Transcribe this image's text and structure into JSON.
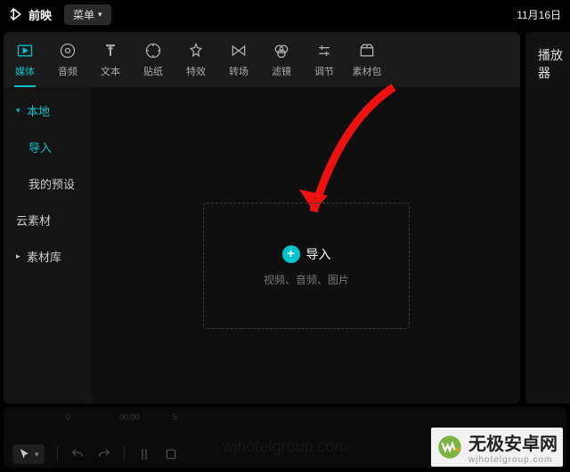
{
  "titlebar": {
    "app_name": "前映",
    "menu_label": "菜单",
    "date": "11月16日"
  },
  "tabs": [
    {
      "id": "media",
      "label": "媒体",
      "icon": "media",
      "active": true
    },
    {
      "id": "audio",
      "label": "音频",
      "icon": "audio"
    },
    {
      "id": "text",
      "label": "文本",
      "icon": "text"
    },
    {
      "id": "sticker",
      "label": "贴纸",
      "icon": "sticker"
    },
    {
      "id": "effect",
      "label": "特效",
      "icon": "effect"
    },
    {
      "id": "transition",
      "label": "转场",
      "icon": "transition"
    },
    {
      "id": "filter",
      "label": "滤镜",
      "icon": "filter"
    },
    {
      "id": "adjust",
      "label": "调节",
      "icon": "adjust"
    },
    {
      "id": "pack",
      "label": "素材包",
      "icon": "pack"
    }
  ],
  "sidebar": [
    {
      "label": "本地",
      "expandable": true,
      "expanded": true,
      "active": true
    },
    {
      "label": "导入",
      "indent": true,
      "active": true
    },
    {
      "label": "我的预设",
      "indent": true
    },
    {
      "label": "云素材"
    },
    {
      "label": "素材库",
      "expandable": true,
      "expanded": false
    }
  ],
  "dropzone": {
    "import_label": "导入",
    "hint": "视频、音频、图片"
  },
  "player": {
    "title": "播放器"
  },
  "timeline": {
    "ticks": [
      "0",
      "00:00",
      "5"
    ]
  },
  "watermark": {
    "brand": "无极安卓网",
    "domain": "wjhotelgroup.com",
    "faint": "wjhotelgroup.com"
  }
}
